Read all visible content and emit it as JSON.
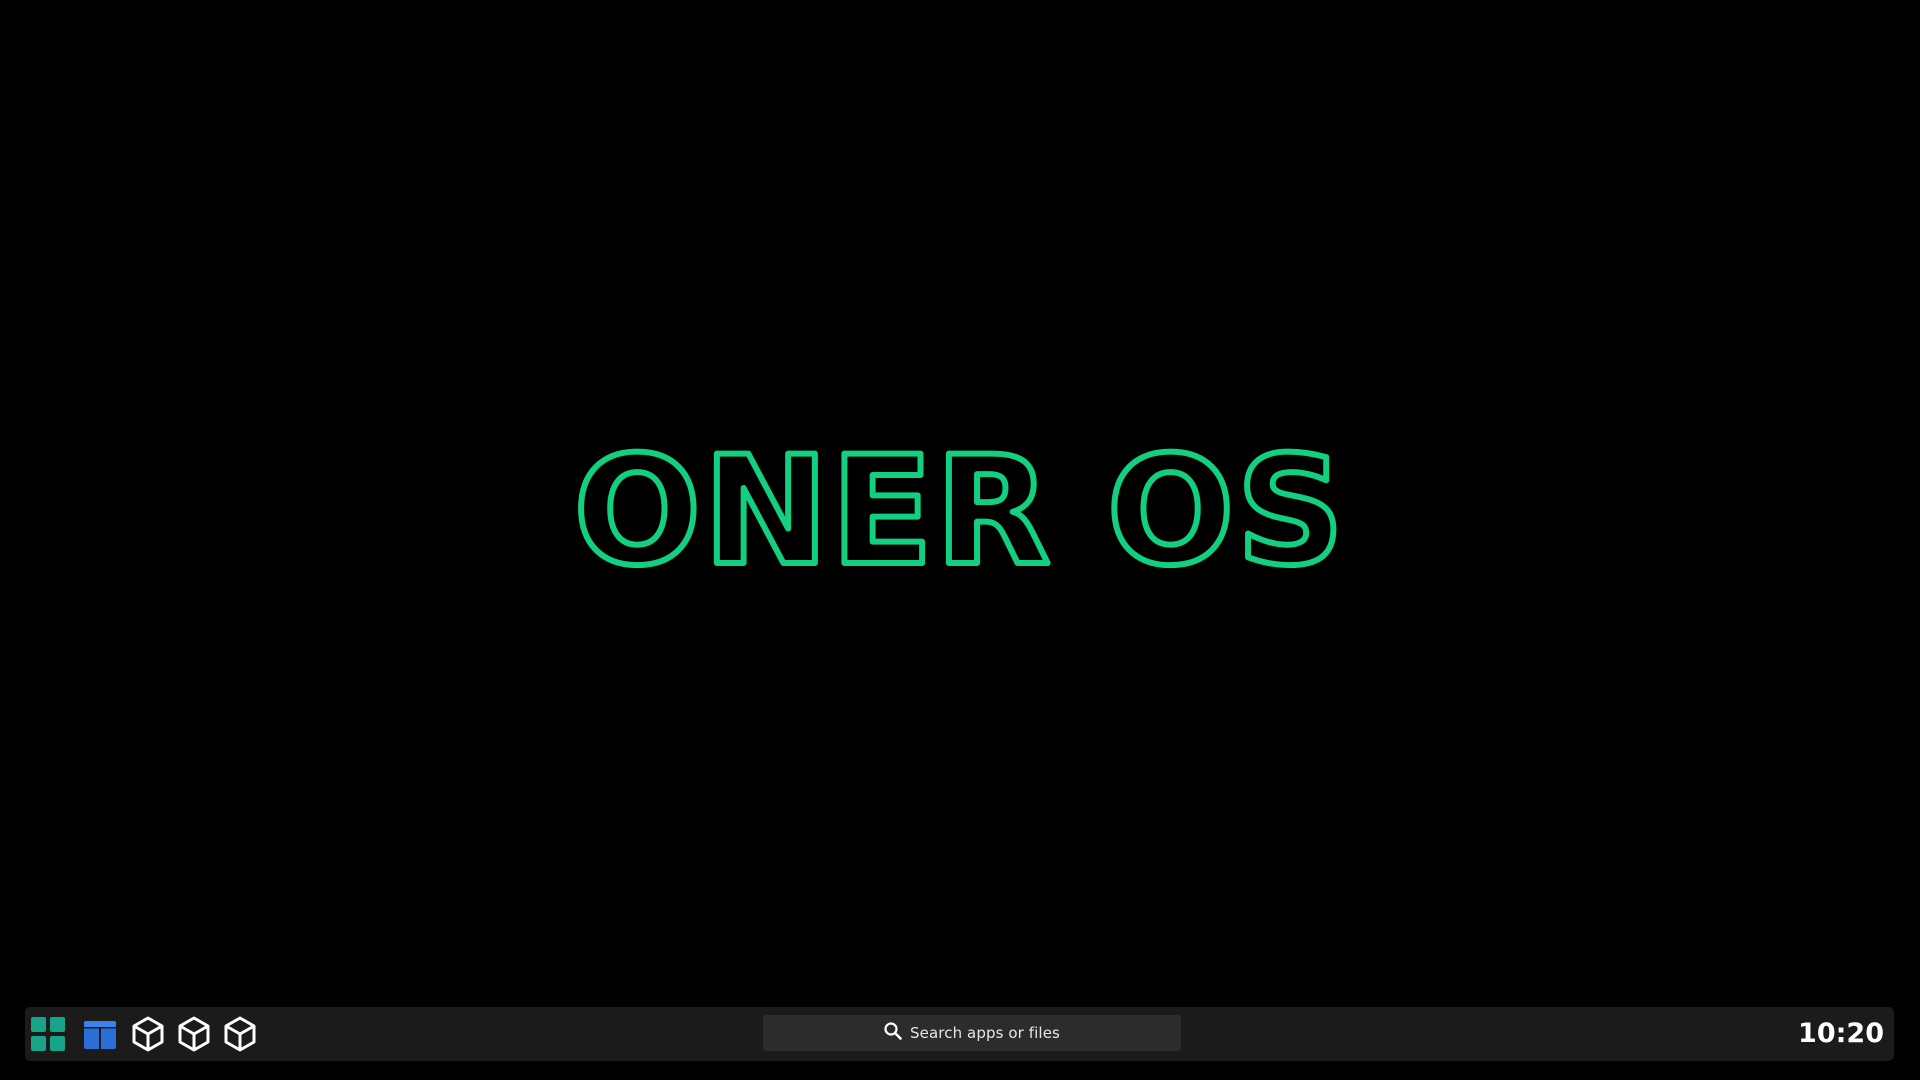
{
  "desktop": {
    "background_color": "#000000",
    "brand": {
      "title": "ONER OS",
      "color": "#12d07f"
    }
  },
  "taskbar": {
    "background_color": "#1b1b1b",
    "items": [
      {
        "name": "app-launcher-grid-icon",
        "color": "#17a589"
      },
      {
        "name": "file-manager-icon",
        "color": "#2b6fd6"
      },
      {
        "name": "app-cube-icon",
        "color": "#ffffff"
      },
      {
        "name": "app-cube-icon",
        "color": "#ffffff"
      },
      {
        "name": "app-cube-icon",
        "color": "#ffffff"
      }
    ],
    "search": {
      "icon": "search-icon",
      "placeholder": "Search apps or files"
    },
    "clock": "10:20"
  }
}
